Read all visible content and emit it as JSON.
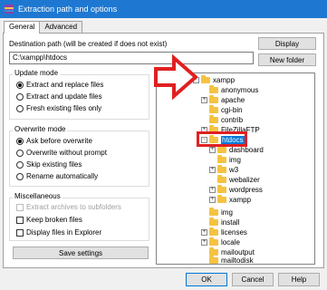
{
  "window": {
    "title": "Extraction path and options"
  },
  "tabs": [
    {
      "label": "General"
    },
    {
      "label": "Advanced"
    }
  ],
  "destination": {
    "label": "Destination path (will be created if does not exist)",
    "value": "C:\\xampp\\htdocs"
  },
  "buttons": {
    "display": "Display",
    "new_folder": "New folder",
    "save_settings": "Save settings",
    "ok": "OK",
    "cancel": "Cancel",
    "help": "Help"
  },
  "update_mode": {
    "title": "Update mode",
    "options": [
      {
        "label": "Extract and replace files",
        "selected": true
      },
      {
        "label": "Extract and update files",
        "selected": false
      },
      {
        "label": "Fresh existing files only",
        "selected": false
      }
    ]
  },
  "overwrite_mode": {
    "title": "Overwrite mode",
    "options": [
      {
        "label": "Ask before overwrite",
        "selected": true
      },
      {
        "label": "Overwrite without prompt",
        "selected": false
      },
      {
        "label": "Skip existing files",
        "selected": false
      },
      {
        "label": "Rename automatically",
        "selected": false
      }
    ]
  },
  "misc": {
    "title": "Miscellaneous",
    "options": [
      {
        "label": "Extract archives to subfolders",
        "checked": false,
        "disabled": true
      },
      {
        "label": "Keep broken files",
        "checked": false,
        "disabled": false
      },
      {
        "label": "Display files in Explorer",
        "checked": false,
        "disabled": false
      }
    ]
  },
  "tree": {
    "items": [
      {
        "label": "xampp",
        "expander": "-"
      },
      {
        "label": "anonymous",
        "expander": ""
      },
      {
        "label": "apache",
        "expander": "+"
      },
      {
        "label": "cgi-bin",
        "expander": ""
      },
      {
        "label": "contrib",
        "expander": ""
      },
      {
        "label": "FileZillaFTP",
        "expander": "+"
      },
      {
        "label": "htdocs",
        "expander": "-",
        "selected": true
      },
      {
        "label": "dashboard",
        "expander": "+"
      },
      {
        "label": "img",
        "expander": ""
      },
      {
        "label": "w3",
        "expander": "+"
      },
      {
        "label": "webalizer",
        "expander": ""
      },
      {
        "label": "wordpress",
        "expander": "+"
      },
      {
        "label": "xampp",
        "expander": "+"
      },
      {
        "label": "img",
        "expander": ""
      },
      {
        "label": "install",
        "expander": ""
      },
      {
        "label": "licenses",
        "expander": "+"
      },
      {
        "label": "locale",
        "expander": "+"
      },
      {
        "label": "mailoutput",
        "expander": ""
      },
      {
        "label": "mailtodisk",
        "expander": ""
      }
    ]
  },
  "colors": {
    "titlebar": "#1e78d2",
    "selection": "#0078d7",
    "annotation": "#e02020"
  }
}
